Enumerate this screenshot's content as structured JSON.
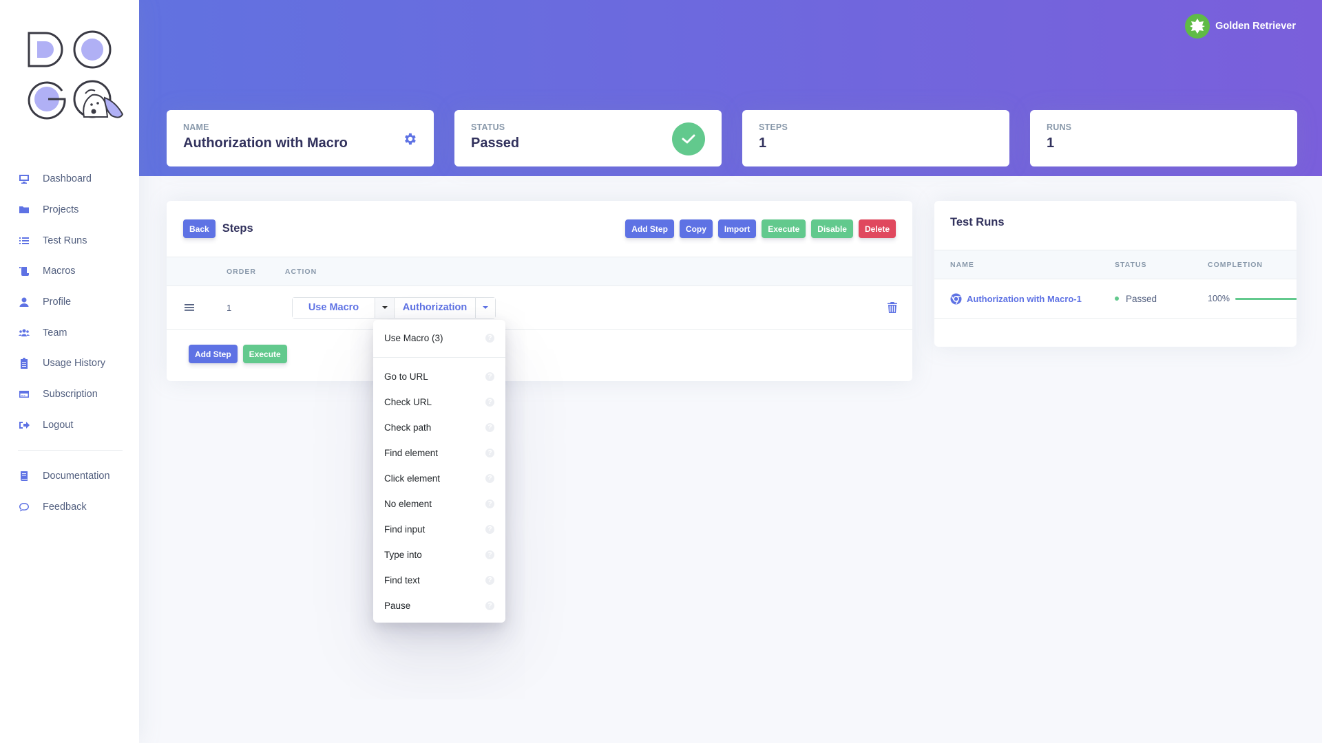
{
  "brand": {
    "logo_text": "DOGQ"
  },
  "user": {
    "name": "Golden Retriever",
    "avatar_color": "#5fbb46"
  },
  "sidebar": {
    "items": [
      {
        "label": "Dashboard",
        "icon": "monitor-icon"
      },
      {
        "label": "Projects",
        "icon": "folder-icon"
      },
      {
        "label": "Test Runs",
        "icon": "list-icon"
      },
      {
        "label": "Macros",
        "icon": "scroll-icon"
      },
      {
        "label": "Profile",
        "icon": "user-icon"
      },
      {
        "label": "Team",
        "icon": "users-icon"
      },
      {
        "label": "Usage History",
        "icon": "clipboard-icon"
      },
      {
        "label": "Subscription",
        "icon": "credit-card-icon"
      },
      {
        "label": "Logout",
        "icon": "sign-out-icon"
      }
    ],
    "secondary": [
      {
        "label": "Documentation",
        "icon": "book-icon"
      },
      {
        "label": "Feedback",
        "icon": "comment-icon"
      }
    ]
  },
  "stats": {
    "name": {
      "label": "NAME",
      "value": "Authorization with Macro"
    },
    "status": {
      "label": "STATUS",
      "value": "Passed"
    },
    "steps": {
      "label": "STEPS",
      "value": "1"
    },
    "runs": {
      "label": "RUNS",
      "value": "1"
    }
  },
  "steps_panel": {
    "back_label": "Back",
    "title": "Steps",
    "toolbar": {
      "add_step": "Add Step",
      "copy": "Copy",
      "import": "Import",
      "execute": "Execute",
      "disable": "Disable",
      "delete": "Delete"
    },
    "columns": {
      "order": "ORDER",
      "action": "ACTION"
    },
    "rows": [
      {
        "order": "1",
        "action": "Use Macro",
        "macro": "Authorization"
      }
    ],
    "footer": {
      "add_step": "Add Step",
      "execute": "Execute"
    }
  },
  "action_dropdown": {
    "items": [
      "Use Macro (3)",
      "Go to URL",
      "Check URL",
      "Check path",
      "Find element",
      "Click element",
      "No element",
      "Find input",
      "Type into",
      "Find text",
      "Pause"
    ],
    "help_glyph": "?"
  },
  "test_runs": {
    "title": "Test Runs",
    "columns": {
      "name": "NAME",
      "status": "STATUS",
      "completion": "COMPLETION"
    },
    "rows": [
      {
        "name": "Authorization with Macro-1",
        "browser": "chrome-icon",
        "status": "Passed",
        "completion_label": "100%",
        "completion": 1.0
      }
    ]
  },
  "colors": {
    "primary": "#5e72e4",
    "success": "#62c98d",
    "danger": "#e0485e",
    "header_start": "#6172e0",
    "header_end": "#7a5fdb"
  }
}
